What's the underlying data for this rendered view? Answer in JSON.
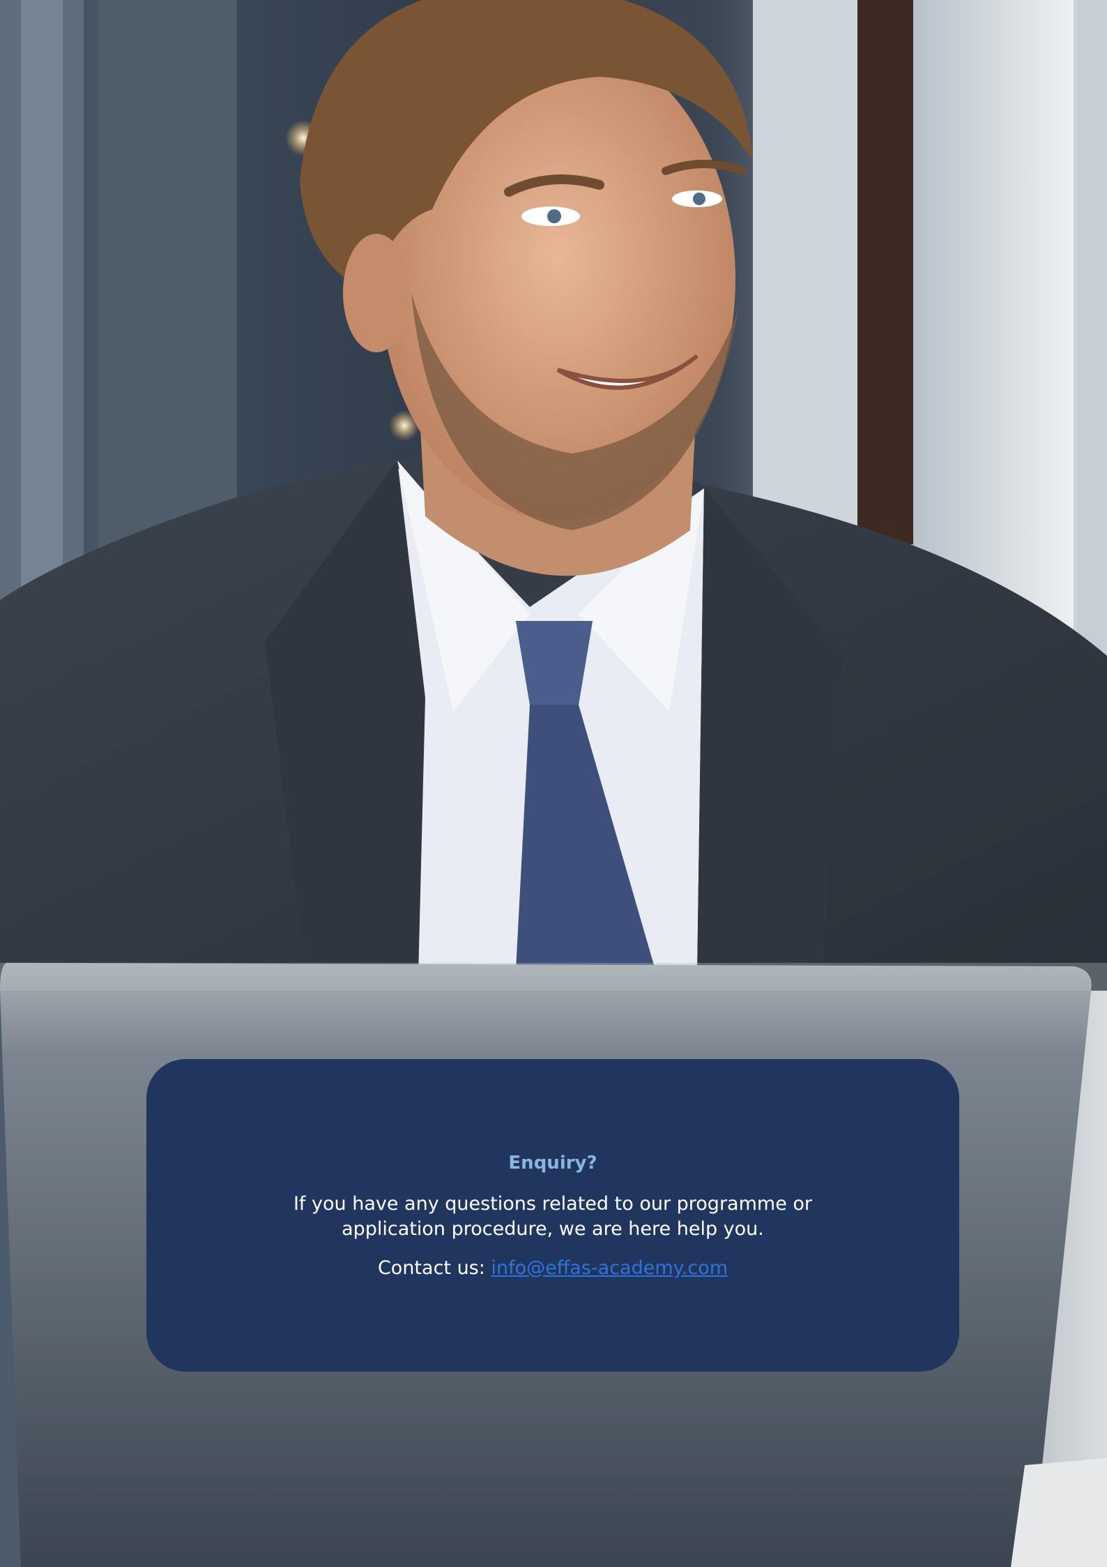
{
  "hero_image": {
    "icon": "smiling-businessman-photo"
  },
  "enquiry": {
    "title": "Enquiry?",
    "text": "If you have any questions related to our programme or application procedure, we are here help you.",
    "contact_label": "Contact us:",
    "email": "info@effas-academy.com"
  },
  "colors": {
    "card_background": "#21365f",
    "title": "#8ab4e2",
    "link": "#2f73d8",
    "text": "#ffffff"
  }
}
